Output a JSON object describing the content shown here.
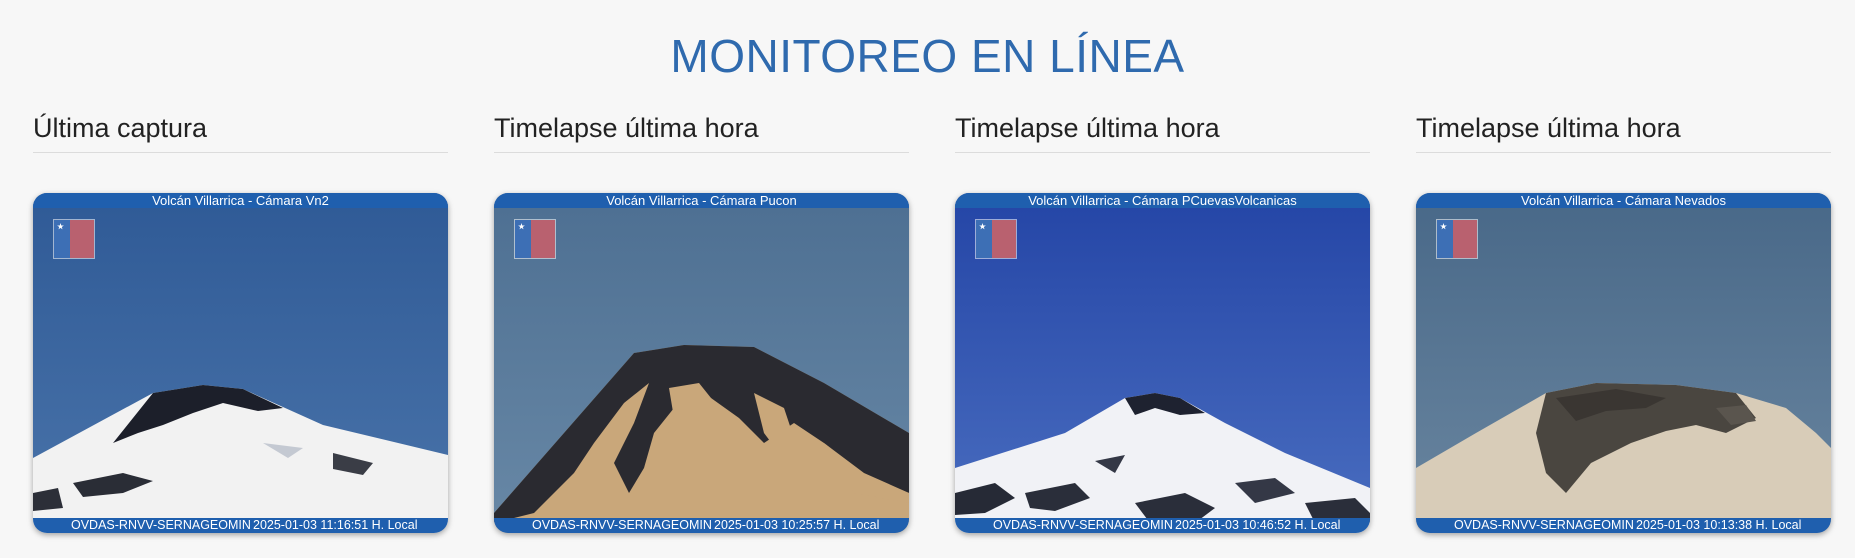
{
  "page": {
    "title": "MONITOREO EN LÍNEA"
  },
  "columns": [
    {
      "heading": "Última captura",
      "camera_title": "Volcán Villarrica - Cámara Vn2",
      "source": "OVDAS-RNVV-SERNAGEOMIN",
      "timestamp": "2025-01-03 11:16:51 H. Local"
    },
    {
      "heading": "Timelapse última hora",
      "camera_title": "Volcán Villarrica - Cámara Pucon",
      "source": "OVDAS-RNVV-SERNAGEOMIN",
      "timestamp": "2025-01-03 10:25:57 H. Local"
    },
    {
      "heading": "Timelapse última hora",
      "camera_title": "Volcán Villarrica - Cámara PCuevasVolcanicas",
      "source": "OVDAS-RNVV-SERNAGEOMIN",
      "timestamp": "2025-01-03 10:46:52 H. Local"
    },
    {
      "heading": "Timelapse última hora",
      "camera_title": "Volcán Villarrica - Cámara Nevados",
      "source": "OVDAS-RNVV-SERNAGEOMIN",
      "timestamp": "2025-01-03 10:13:38 H. Local"
    }
  ],
  "colors": {
    "title_blue": "#2f6aae",
    "banner_blue": "#1f5fae",
    "sky_vn2": "#3e68a0",
    "sky_pucon": "#56799a",
    "sky_cuevas": "#2c4fb0",
    "sky_nevados": "#4f6f8c"
  }
}
